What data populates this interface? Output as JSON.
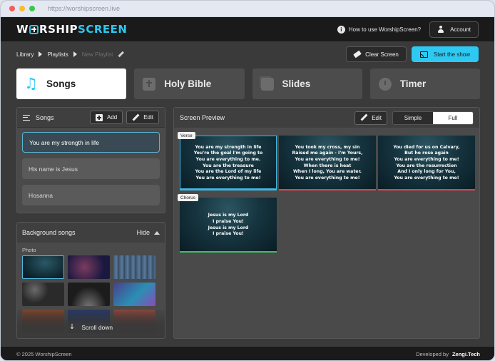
{
  "browser": {
    "url": "https://worshipscreen.live"
  },
  "header": {
    "logo_prefix": "W",
    "logo_rest": "RSHIP",
    "logo_accent": "SCREEN",
    "help_label": "How to use WorshipScreen?",
    "account_label": "Account"
  },
  "breadcrumb": {
    "items": [
      "Library",
      "Playlists",
      "New Playlist"
    ]
  },
  "actions": {
    "clear_label": "Clear Screen",
    "start_label": "Start the show"
  },
  "tabs": [
    {
      "label": "Songs",
      "icon": "music-note-icon",
      "active": true
    },
    {
      "label": "Holy Bible",
      "icon": "bible-icon",
      "active": false
    },
    {
      "label": "Slides",
      "icon": "slides-icon",
      "active": false
    },
    {
      "label": "Timer",
      "icon": "timer-icon",
      "active": false
    }
  ],
  "songs_panel": {
    "title": "Songs",
    "add_label": "Add",
    "edit_label": "Edit",
    "items": [
      {
        "title": "You are my strength in life",
        "selected": true
      },
      {
        "title": "His name is Jesus",
        "selected": false
      },
      {
        "title": "Hosanna",
        "selected": false
      }
    ]
  },
  "background_panel": {
    "title": "Background songs",
    "hide_label": "Hide",
    "photo_label": "Photo",
    "scroll_label": "Scroll down"
  },
  "preview": {
    "title": "Screen Preview",
    "edit_label": "Edit",
    "mode_simple": "Simple",
    "mode_full": "Full",
    "verse_tag": "Verse",
    "chorus_tag": "Chorus",
    "slides": [
      {
        "lines": [
          "You are my strength in life",
          "You're the goal I'm going to",
          "You are everything to me.",
          "You are the treasure",
          "You are the Lord of my life",
          "You are everything to me!"
        ],
        "selected": true,
        "bar_color": "#3fb8e6"
      },
      {
        "lines": [
          "You took my cross, my sin",
          "Raised me again - I'm Yours,",
          "You are everything to me!",
          "When there is heat",
          "When I long, You are water.",
          "You are everything to me!"
        ],
        "selected": false,
        "bar_color": "#e2424f"
      },
      {
        "lines": [
          "You died for us on Calvary,",
          "But he rose again",
          "You are everything to me!",
          "You are the resurrection",
          "And I only long for You,",
          "You are everything to me!"
        ],
        "selected": false,
        "bar_color": "#e2424f"
      },
      {
        "lines": [
          "Jesus is my Lord",
          "I praise You!",
          "Jesus is my Lord",
          "I praise You!"
        ],
        "selected": false,
        "bar_color": "#3ec15a"
      }
    ]
  },
  "footer": {
    "copyright": "© 2025 WorshipScreen",
    "developed_by": "Developed by",
    "developer": "Zengi.Tech"
  },
  "colors": {
    "accent": "#2ec9f2",
    "verse_bar": "#e2424f",
    "chorus_bar": "#3ec15a"
  }
}
